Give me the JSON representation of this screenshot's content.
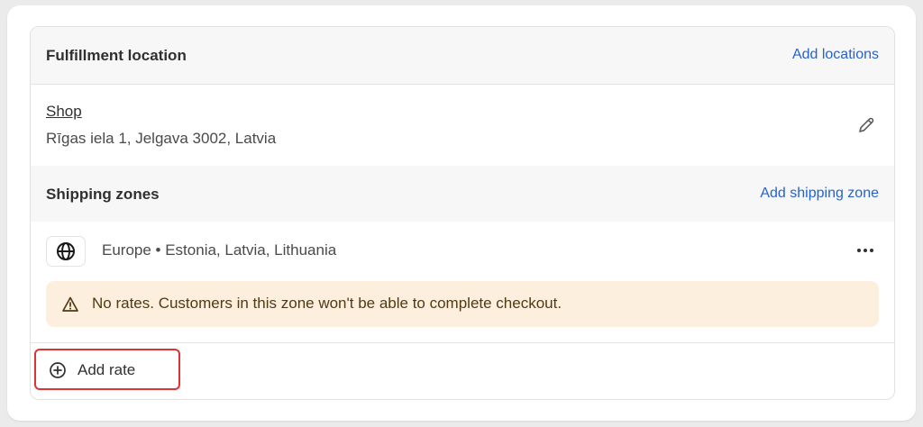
{
  "fulfillment": {
    "title": "Fulfillment location",
    "add_locations_label": "Add locations",
    "location": {
      "name": "Shop",
      "address": "Rīgas iela 1, Jelgava 3002, Latvia"
    }
  },
  "shipping_zones": {
    "title": "Shipping zones",
    "add_zone_label": "Add shipping zone",
    "zone": {
      "icon": "globe-icon",
      "label": "Europe • Estonia, Latvia, Lithuania"
    },
    "warning": {
      "icon": "warning-triangle-icon",
      "text": "No rates. Customers in this zone won't be able to complete checkout."
    },
    "add_rate": {
      "icon": "plus-circle-icon",
      "label": "Add rate"
    }
  },
  "colors": {
    "link": "#2463d1",
    "warning_bg": "#fdefdd",
    "highlight_border": "#e03232"
  }
}
